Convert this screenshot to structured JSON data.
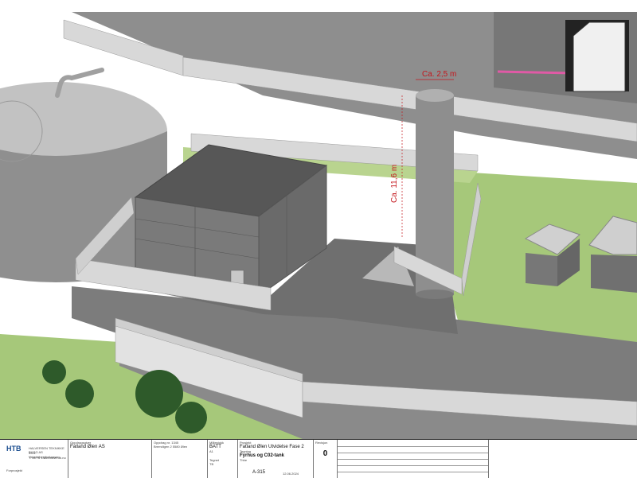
{
  "drawing": {
    "dimension_width": "Ca. 2,5 m",
    "dimension_height": "Ca. 11,6 m"
  },
  "titleblock": {
    "company": "HALVERSEN TEKNIKKE BYGG AS",
    "company_sub": "3321 Veksterbergboknesen",
    "company_phone": "T: 46 76 14 54",
    "company_web": "www.htb.no",
    "logo_text": "HTB",
    "client_label": "Oppdragsgiver",
    "client": "Fatland Ølen AS",
    "client_note": "Forprosjekt",
    "address_label": "Oppdrag nr. 1345",
    "address": "Bremdigen 2 5580 Ølen",
    "project_label": "Prosjekt",
    "project": "Fatland Ølen Utvidelse Fase 2",
    "drawing_title_label": "Tegning",
    "drawing_title": "Fyrhus og C02-tank",
    "scale_label": "Målestokk",
    "scale": "BATT",
    "sheet_size": "A1",
    "revision_label": "Revisjon",
    "revision": "0",
    "drawn_label": "Tegnet",
    "drawn": "TB",
    "checked_label": "Kontr.",
    "checked": "Thhe",
    "drawing_no": "A-315",
    "date": "12.06.2024"
  },
  "colors": {
    "grass": "#a6c87a",
    "concrete": "#9b9b9b",
    "building": "#6c6c6c",
    "dimension": "#c4161c",
    "magenta": "#e05aa6"
  }
}
